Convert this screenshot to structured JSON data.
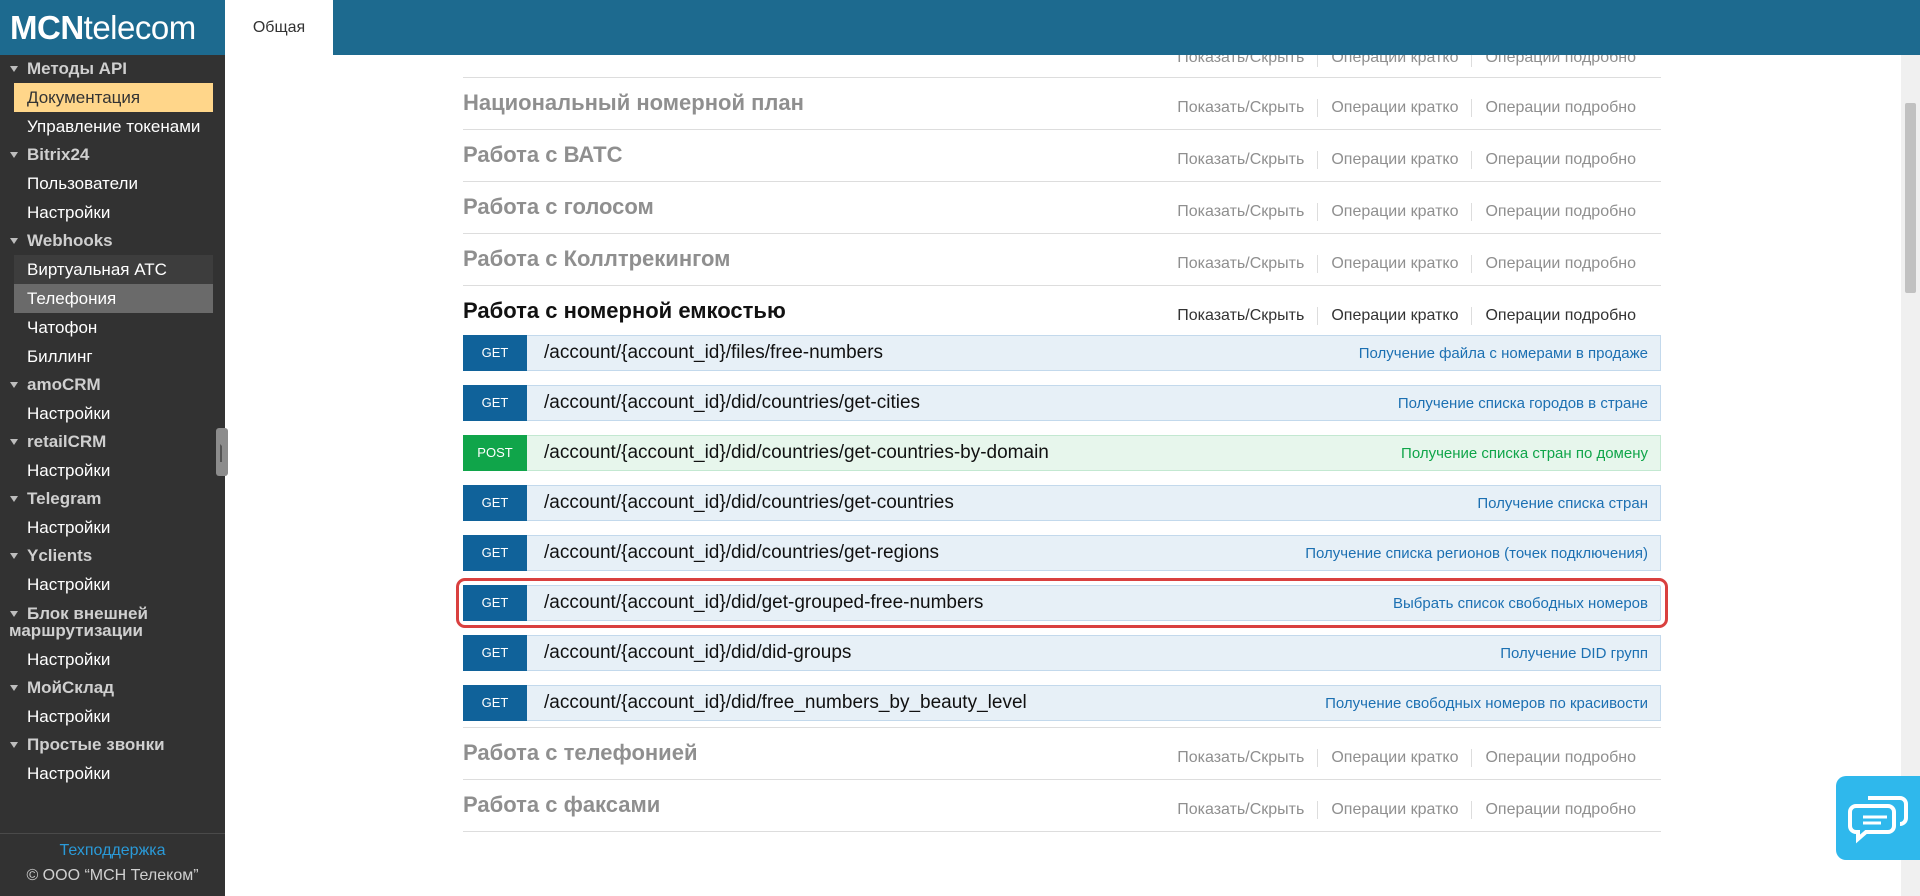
{
  "logo": {
    "part1": "MCN",
    "part2": "telecom"
  },
  "topbar": {
    "tab_general": "Общая"
  },
  "sidebar": {
    "groups": [
      {
        "title": "Методы API",
        "items": [
          "Документация",
          "Управление токенами"
        ]
      },
      {
        "title": "Bitrix24",
        "items": [
          "Пользователи",
          "Настройки"
        ]
      },
      {
        "title": "Webhooks",
        "items": [
          "Виртуальная АТС",
          "Телефония",
          "Чатофон",
          "Биллинг"
        ]
      },
      {
        "title": "amoCRM",
        "items": [
          "Настройки"
        ]
      },
      {
        "title": "retailCRM",
        "items": [
          "Настройки"
        ]
      },
      {
        "title": "Telegram",
        "items": [
          "Настройки"
        ]
      },
      {
        "title": "Yclients",
        "items": [
          "Настройки"
        ]
      },
      {
        "title_line1": "Блок внешней",
        "title_line2": "маршрутизации",
        "items": [
          "Настройки"
        ]
      },
      {
        "title": "МойСклад",
        "items": [
          "Настройки"
        ]
      },
      {
        "title": "Простые звонки",
        "items": [
          "Настройки"
        ]
      }
    ],
    "support": "Техподдержка",
    "copyright": "© ООО “МСН Телеком”"
  },
  "ops": {
    "show_hide": "Показать/Скрыть",
    "brief": "Операции кратко",
    "detailed": "Операции подробно"
  },
  "sections": [
    {
      "title": "Национальный номерной план"
    },
    {
      "title": "Работа с ВАТС"
    },
    {
      "title": "Работа с голосом"
    },
    {
      "title": "Работа с Коллтрекингом"
    },
    {
      "title": "Работа с номерной емкостью"
    },
    {
      "title": "Работа с телефонией"
    },
    {
      "title": "Работа с факсами"
    }
  ],
  "endpoints": [
    {
      "method": "GET",
      "path": "/account/{account_id}/files/free-numbers",
      "desc": "Получение файла с номерами в продаже"
    },
    {
      "method": "GET",
      "path": "/account/{account_id}/did/countries/get-cities",
      "desc": "Получение списка городов в стране"
    },
    {
      "method": "POST",
      "path": "/account/{account_id}/did/countries/get-countries-by-domain",
      "desc": "Получение списка стран по домену"
    },
    {
      "method": "GET",
      "path": "/account/{account_id}/did/countries/get-countries",
      "desc": "Получение списка стран"
    },
    {
      "method": "GET",
      "path": "/account/{account_id}/did/countries/get-regions",
      "desc": "Получение списка регионов (точек подключения)"
    },
    {
      "method": "GET",
      "path": "/account/{account_id}/did/get-grouped-free-numbers",
      "desc": "Выбрать список свободных номеров"
    },
    {
      "method": "GET",
      "path": "/account/{account_id}/did/did-groups",
      "desc": "Получение DID групп"
    },
    {
      "method": "GET",
      "path": "/account/{account_id}/did/free_numbers_by_beauty_level",
      "desc": "Получение свободных номеров по красивости"
    }
  ]
}
